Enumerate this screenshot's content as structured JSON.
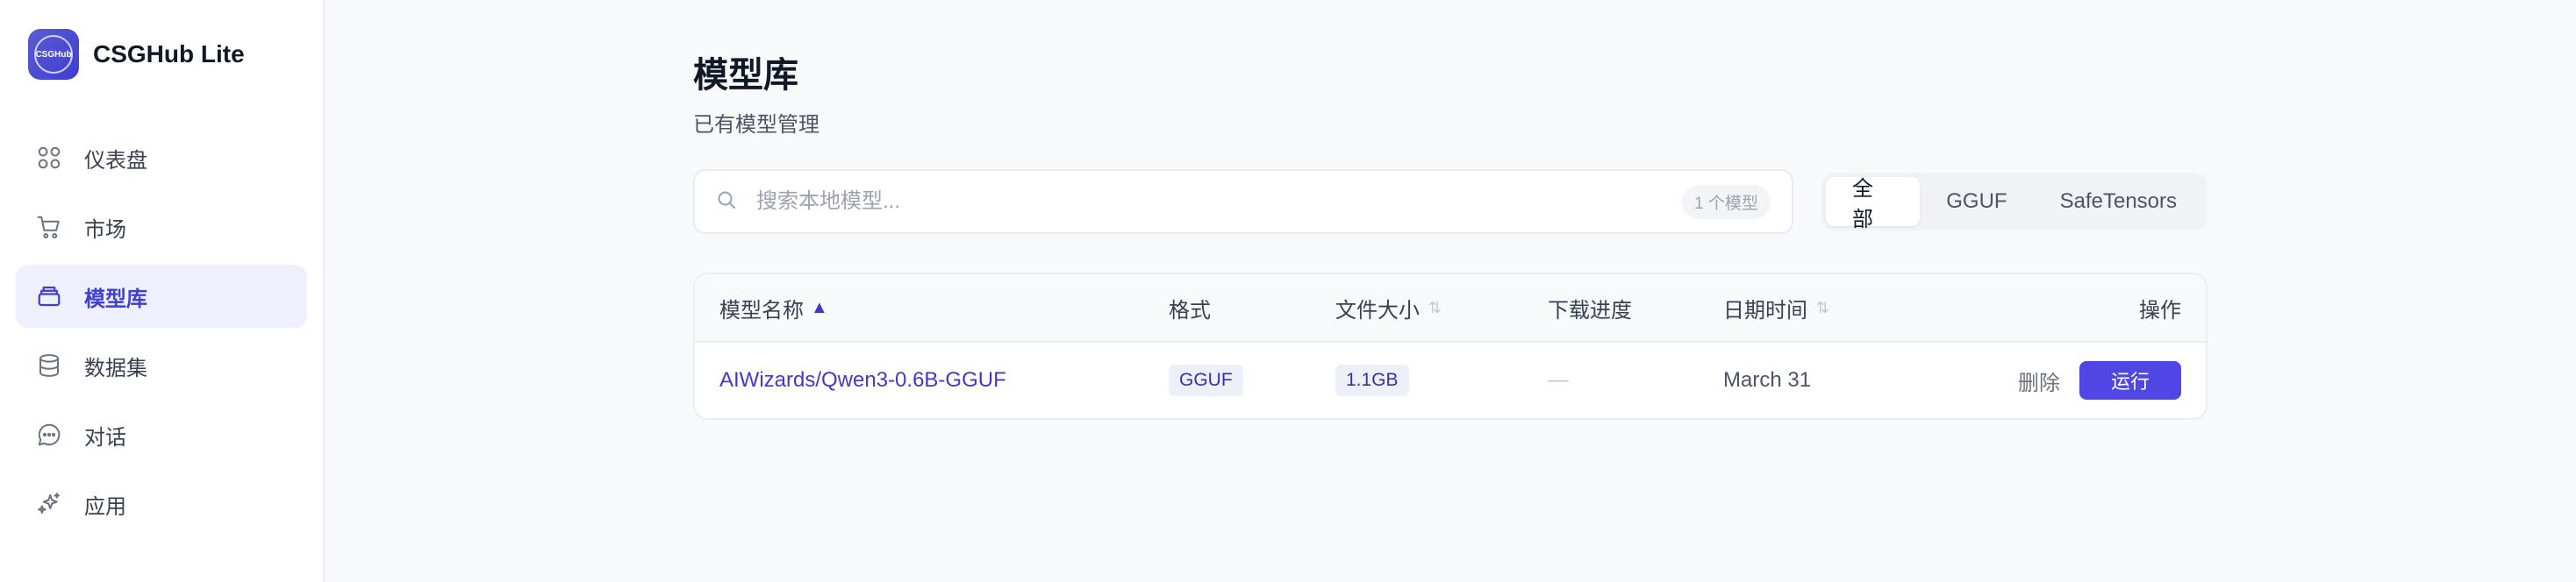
{
  "app": {
    "logo_text": "CSGHub",
    "name": "CSGHub Lite"
  },
  "sidebar": {
    "items": [
      {
        "label": "仪表盘",
        "icon": "dashboard-icon"
      },
      {
        "label": "市场",
        "icon": "cart-icon"
      },
      {
        "label": "模型库",
        "icon": "model-library-icon",
        "active": true
      },
      {
        "label": "数据集",
        "icon": "database-icon"
      },
      {
        "label": "对话",
        "icon": "chat-icon"
      },
      {
        "label": "应用",
        "icon": "sparkles-icon"
      }
    ]
  },
  "main": {
    "title": "模型库",
    "subtitle": "已有模型管理",
    "search": {
      "placeholder": "搜索本地模型...",
      "value": "",
      "count_badge": "1 个模型"
    },
    "filter_tabs": [
      {
        "label": "全部",
        "active": true
      },
      {
        "label": "GGUF",
        "active": false
      },
      {
        "label": "SafeTensors",
        "active": false
      }
    ],
    "table": {
      "headers": {
        "name": "模型名称",
        "name_sort": "▲",
        "format": "格式",
        "size": "文件大小",
        "progress": "下载进度",
        "date": "日期时间",
        "actions": "操作"
      },
      "rows": [
        {
          "name": "AIWizards/Qwen3-0.6B-GGUF",
          "format": "GGUF",
          "size": "1.1GB",
          "progress": "—",
          "date": "March 31",
          "delete_label": "删除",
          "run_label": "运行"
        }
      ]
    }
  },
  "colors": {
    "accent": "#4f46e5",
    "active_nav_bg": "#eef0fd",
    "link": "#4338ca"
  }
}
